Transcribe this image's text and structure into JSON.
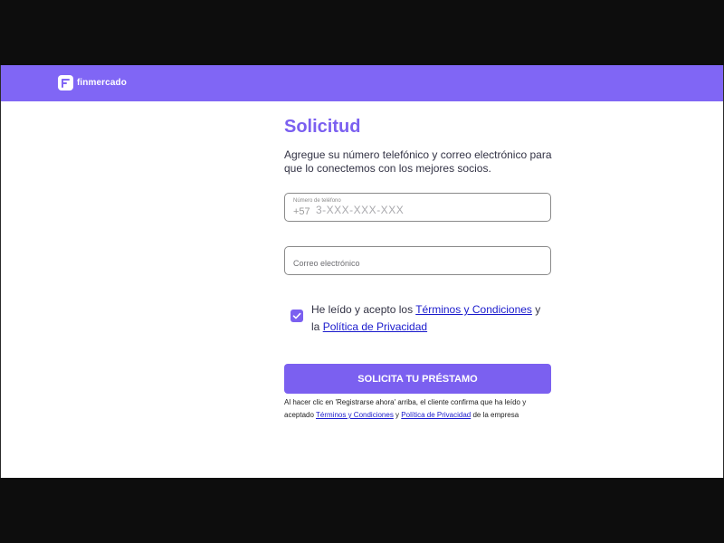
{
  "brand": {
    "name": "finmercado"
  },
  "form": {
    "title": "Solicitud",
    "subtitle": "Agregue su número telefónico y correo electrónico para que lo conectemos con los mejores socios.",
    "phone": {
      "label": "Número de teléfono",
      "prefix": "+57",
      "placeholder": "3-XXX-XXX-XXX"
    },
    "email": {
      "placeholder": "Correo electrónico"
    },
    "consent": {
      "checked": true,
      "text_1": "He leído y acepto los",
      "terms_link": "Términos y Condiciones",
      "text_2": "y la",
      "privacy_link": "Política de Privacidad"
    },
    "cta_label": "SOLICITA TU PRÉSTAMO",
    "legal": {
      "text_1": "Al hacer clic en 'Registrarse ahora' arriba, el cliente confirma que ha leído y aceptado",
      "terms_link": "Términos y Condiciones",
      "text_2": "y",
      "privacy_link": "Política de Privacidad",
      "text_3": "de la empresa"
    }
  },
  "colors": {
    "brand": "#8066f5",
    "accent": "#7b60f0",
    "link": "#1a1acc"
  },
  "icons": {
    "logo": "finmercado-logo-icon",
    "check": "check-icon"
  }
}
